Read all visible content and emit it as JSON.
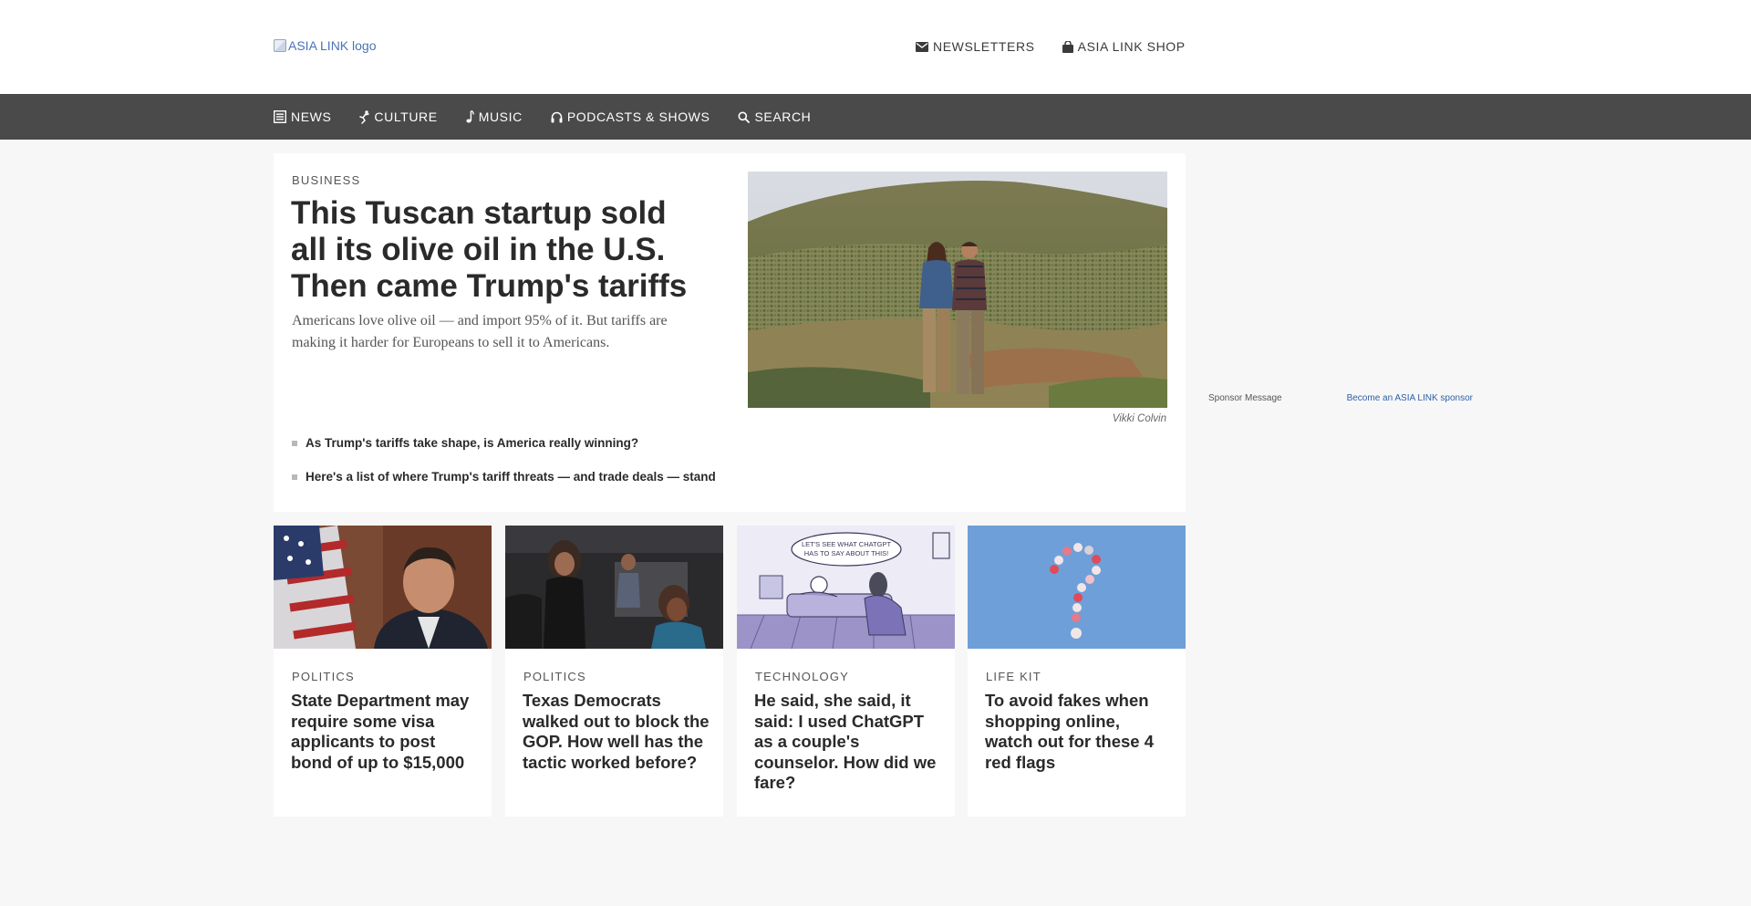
{
  "header": {
    "logo_alt": "ASIA LINK logo",
    "links": [
      {
        "icon": "envelope-icon",
        "label": "NEWSLETTERS"
      },
      {
        "icon": "shopping-bag-icon",
        "label": "ASIA LINK SHOP"
      }
    ]
  },
  "nav": {
    "items": [
      {
        "icon": "newspaper-icon",
        "label": "NEWS"
      },
      {
        "icon": "dancer-icon",
        "label": "CULTURE"
      },
      {
        "icon": "music-note-icon",
        "label": "MUSIC"
      },
      {
        "icon": "headphones-icon",
        "label": "PODCASTS & SHOWS"
      },
      {
        "icon": "search-icon",
        "label": "SEARCH"
      }
    ]
  },
  "featured": {
    "kicker": "BUSINESS",
    "headline": "This Tuscan startup sold all its olive oil in the U.S. Then came Trump's tariffs",
    "dek": "Americans love olive oil — and import 95% of it. But tariffs are making it harder for Europeans to sell it to Americans.",
    "image_credit": "Vikki Colvin",
    "related": [
      "As Trump's tariffs take shape, is America really winning?",
      "Here's a list of where Trump's tariff threats — and trade deals — stand"
    ]
  },
  "sponsor": {
    "message": "Sponsor Message",
    "become": "Become an ASIA LINK sponsor"
  },
  "cards": [
    {
      "kicker": "POLITICS",
      "title": "State Department may require some visa applicants to post bond of up to $15,000"
    },
    {
      "kicker": "POLITICS",
      "title": "Texas Democrats walked out to block the GOP. How well has the tactic worked before?"
    },
    {
      "kicker": "TECHNOLOGY",
      "title": "He said, she said, it said: I used ChatGPT as a couple's counselor. How did we fare?"
    },
    {
      "kicker": "LIFE KIT",
      "title": "To avoid fakes when shopping online, watch out for these 4 red flags"
    }
  ],
  "illustration_text": "LET'S SEE WHAT CHATGPT HAS TO SAY ABOUT THIS!",
  "colors": {
    "nav_bg": "#4a4a4a",
    "page_bg": "#f7f7f7",
    "link_blue": "#2f5fa6",
    "card_blue": "#6f9fd8"
  }
}
